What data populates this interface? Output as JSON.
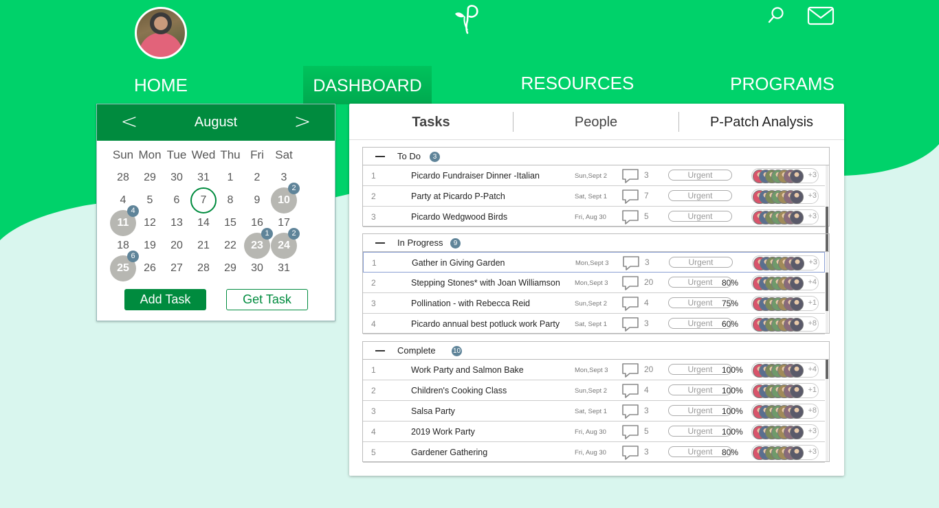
{
  "header": {
    "nav": [
      {
        "label": "HOME"
      },
      {
        "label": "DASHBOARD"
      },
      {
        "label": "RESOURCES"
      },
      {
        "label": "PROGRAMS"
      }
    ]
  },
  "colors": {
    "brand_green": "#00d26a",
    "dark_green": "#008b3e",
    "badge_blue": "#5f8499"
  },
  "icons": {
    "logo": "sprout-p-logo",
    "search": "search-icon",
    "mail": "mail-icon",
    "comment": "comment-icon"
  },
  "calendar": {
    "month": "August",
    "prev": "<",
    "next": ">",
    "weekdays": [
      "Sun",
      "Mon",
      "Tue",
      "Wed",
      "Thu",
      "Fri",
      "Sat"
    ],
    "days": [
      "28",
      "29",
      "30",
      "31",
      "1",
      "2",
      "3",
      "4",
      "5",
      "6",
      "7",
      "8",
      "9",
      "10",
      "11",
      "12",
      "13",
      "14",
      "15",
      "16",
      "17",
      "18",
      "19",
      "20",
      "21",
      "22",
      "23",
      "24",
      "25",
      "26",
      "27",
      "28",
      "29",
      "30",
      "31"
    ],
    "today": "7",
    "busy_days": [
      {
        "day": "10",
        "count": "2"
      },
      {
        "day": "11",
        "count": "4"
      },
      {
        "day": "23",
        "count": "1"
      },
      {
        "day": "24",
        "count": "2"
      },
      {
        "day": "25",
        "count": "6"
      }
    ],
    "add_task": "Add Task",
    "get_task": "Get Task"
  },
  "tabs": [
    "Tasks",
    "People",
    "P-Patch Analysis"
  ],
  "groups": [
    {
      "title": "To Do",
      "count": "3",
      "rows": [
        {
          "num": "1",
          "name": "Picardo Fundraiser Dinner -Italian",
          "date": "Sun,Sept 2",
          "comments": "3",
          "tag": "Urgent",
          "pct": "",
          "more": "+3"
        },
        {
          "num": "2",
          "name": "Party at Picardo P-Patch",
          "date": "Sat, Sept 1",
          "comments": "7",
          "tag": "Urgent",
          "pct": "",
          "more": "+3"
        },
        {
          "num": "3",
          "name": "Picardo Wedgwood Birds",
          "date": "Fri, Aug 30",
          "comments": "5",
          "tag": "Urgent",
          "pct": "",
          "more": "+3"
        }
      ]
    },
    {
      "title": "In Progress",
      "count": "9",
      "rows": [
        {
          "num": "1",
          "name": "Gather in Giving Garden",
          "date": "Mon,Sept 3",
          "comments": "3",
          "tag": "Urgent",
          "pct": "",
          "more": "+3"
        },
        {
          "num": "2",
          "name": "Stepping Stones* with Joan Williamson",
          "date": "Mon,Sept 3",
          "comments": "20",
          "tag": "Urgent",
          "pct": "80%",
          "more": "+4"
        },
        {
          "num": "3",
          "name": "Pollination - with Rebecca Reid",
          "date": "Sun,Sept 2",
          "comments": "4",
          "tag": "Urgent",
          "pct": "75%",
          "more": "+1"
        },
        {
          "num": "4",
          "name": "Picardo annual best potluck work Party",
          "date": "Sat, Sept 1",
          "comments": "3",
          "tag": "Urgent",
          "pct": "60%",
          "more": "+8"
        }
      ]
    },
    {
      "title": "Complete",
      "count": "10",
      "rows": [
        {
          "num": "1",
          "name": "Work Party and Salmon Bake",
          "date": "Mon,Sept 3",
          "comments": "20",
          "tag": "Urgent",
          "pct": "100%",
          "more": "+4"
        },
        {
          "num": "2",
          "name": "Children's Cooking Class",
          "date": "Sun,Sept 2",
          "comments": "4",
          "tag": "Urgent",
          "pct": "100%",
          "more": "+1"
        },
        {
          "num": "3",
          "name": "Salsa Party",
          "date": "Sat, Sept 1",
          "comments": "3",
          "tag": "Urgent",
          "pct": "100%",
          "more": "+8"
        },
        {
          "num": "4",
          "name": "2019 Work Party",
          "date": "Fri, Aug 30",
          "comments": "5",
          "tag": "Urgent",
          "pct": "100%",
          "more": "+3"
        },
        {
          "num": "5",
          "name": "Gardener Gathering",
          "date": "Fri, Aug 30",
          "comments": "3",
          "tag": "Urgent",
          "pct": "80%",
          "more": "+3"
        }
      ]
    }
  ]
}
